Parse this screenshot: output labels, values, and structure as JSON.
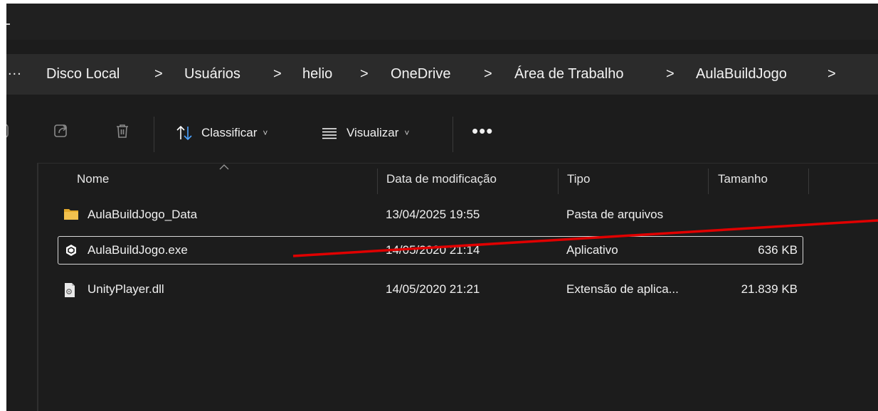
{
  "address": {
    "more_label": "...",
    "crumbs": [
      "Disco Local",
      "Usuários",
      "helio",
      "OneDrive",
      "Área de Trabalho",
      "AulaBuildJogo"
    ],
    "separator": ">"
  },
  "toolbar": {
    "sort_label": "Classificar",
    "view_label": "Visualizar",
    "more_label": "•••",
    "chevron": "˅"
  },
  "columns": {
    "name": "Nome",
    "date": "Data de modificação",
    "type": "Tipo",
    "size": "Tamanho"
  },
  "files": [
    {
      "name": "AulaBuildJogo_Data",
      "date": "13/04/2025 19:55",
      "type": "Pasta de arquivos",
      "size": "",
      "icon": "folder-icon"
    },
    {
      "name": "AulaBuildJogo.exe",
      "date": "14/05/2020 21:14",
      "type": "Aplicativo",
      "size": "636 KB",
      "icon": "unity-app-icon",
      "selected": true
    },
    {
      "name": "UnityPlayer.dll",
      "date": "14/05/2020 21:21",
      "type": "Extensão de aplica...",
      "size": "21.839 KB",
      "icon": "dll-file-icon"
    }
  ],
  "colors": {
    "background": "#1c1c1c",
    "address_bar": "#2b2b2b",
    "folder": "#f2c14e",
    "annotation_line": "#e00000"
  }
}
